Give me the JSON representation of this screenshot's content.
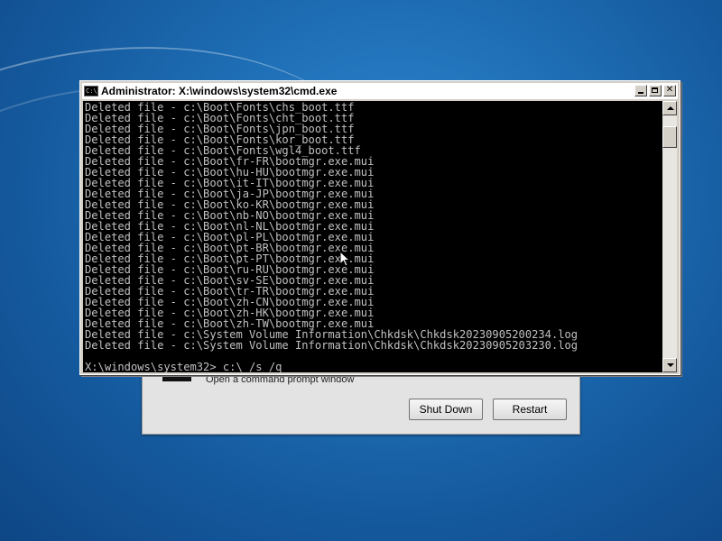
{
  "cmd": {
    "title": "Administrator: X:\\windows\\system32\\cmd.exe",
    "icon_label": "C:\\",
    "output_lines": [
      "Deleted file - c:\\Boot\\Fonts\\chs_boot.ttf",
      "Deleted file - c:\\Boot\\Fonts\\cht_boot.ttf",
      "Deleted file - c:\\Boot\\Fonts\\jpn_boot.ttf",
      "Deleted file - c:\\Boot\\Fonts\\kor_boot.ttf",
      "Deleted file - c:\\Boot\\Fonts\\wgl4_boot.ttf",
      "Deleted file - c:\\Boot\\fr-FR\\bootmgr.exe.mui",
      "Deleted file - c:\\Boot\\hu-HU\\bootmgr.exe.mui",
      "Deleted file - c:\\Boot\\it-IT\\bootmgr.exe.mui",
      "Deleted file - c:\\Boot\\ja-JP\\bootmgr.exe.mui",
      "Deleted file - c:\\Boot\\ko-KR\\bootmgr.exe.mui",
      "Deleted file - c:\\Boot\\nb-NO\\bootmgr.exe.mui",
      "Deleted file - c:\\Boot\\nl-NL\\bootmgr.exe.mui",
      "Deleted file - c:\\Boot\\pl-PL\\bootmgr.exe.mui",
      "Deleted file - c:\\Boot\\pt-BR\\bootmgr.exe.mui",
      "Deleted file - c:\\Boot\\pt-PT\\bootmgr.exe.mui",
      "Deleted file - c:\\Boot\\ru-RU\\bootmgr.exe.mui",
      "Deleted file - c:\\Boot\\sv-SE\\bootmgr.exe.mui",
      "Deleted file - c:\\Boot\\tr-TR\\bootmgr.exe.mui",
      "Deleted file - c:\\Boot\\zh-CN\\bootmgr.exe.mui",
      "Deleted file - c:\\Boot\\zh-HK\\bootmgr.exe.mui",
      "Deleted file - c:\\Boot\\zh-TW\\bootmgr.exe.mui",
      "Deleted file - c:\\System Volume Information\\Chkdsk\\Chkdsk20230905200234.log",
      "Deleted file - c:\\System Volume Information\\Chkdsk\\Chkdsk20230905203230.log"
    ],
    "prompt": "X:\\windows\\system32> c:\\ /s /q"
  },
  "recovery": {
    "description": "Open a command prompt window",
    "shutdown_label": "Shut Down",
    "restart_label": "Restart"
  },
  "colors": {
    "console_bg": "#000000",
    "console_text": "#c0c0c0",
    "desktop_blue": "#1f6fb6"
  },
  "icons": [
    "cmd-app-icon",
    "minimize-icon",
    "maximize-icon",
    "close-icon",
    "scroll-up-arrow-icon",
    "scroll-down-arrow-icon",
    "mouse-pointer-icon"
  ]
}
